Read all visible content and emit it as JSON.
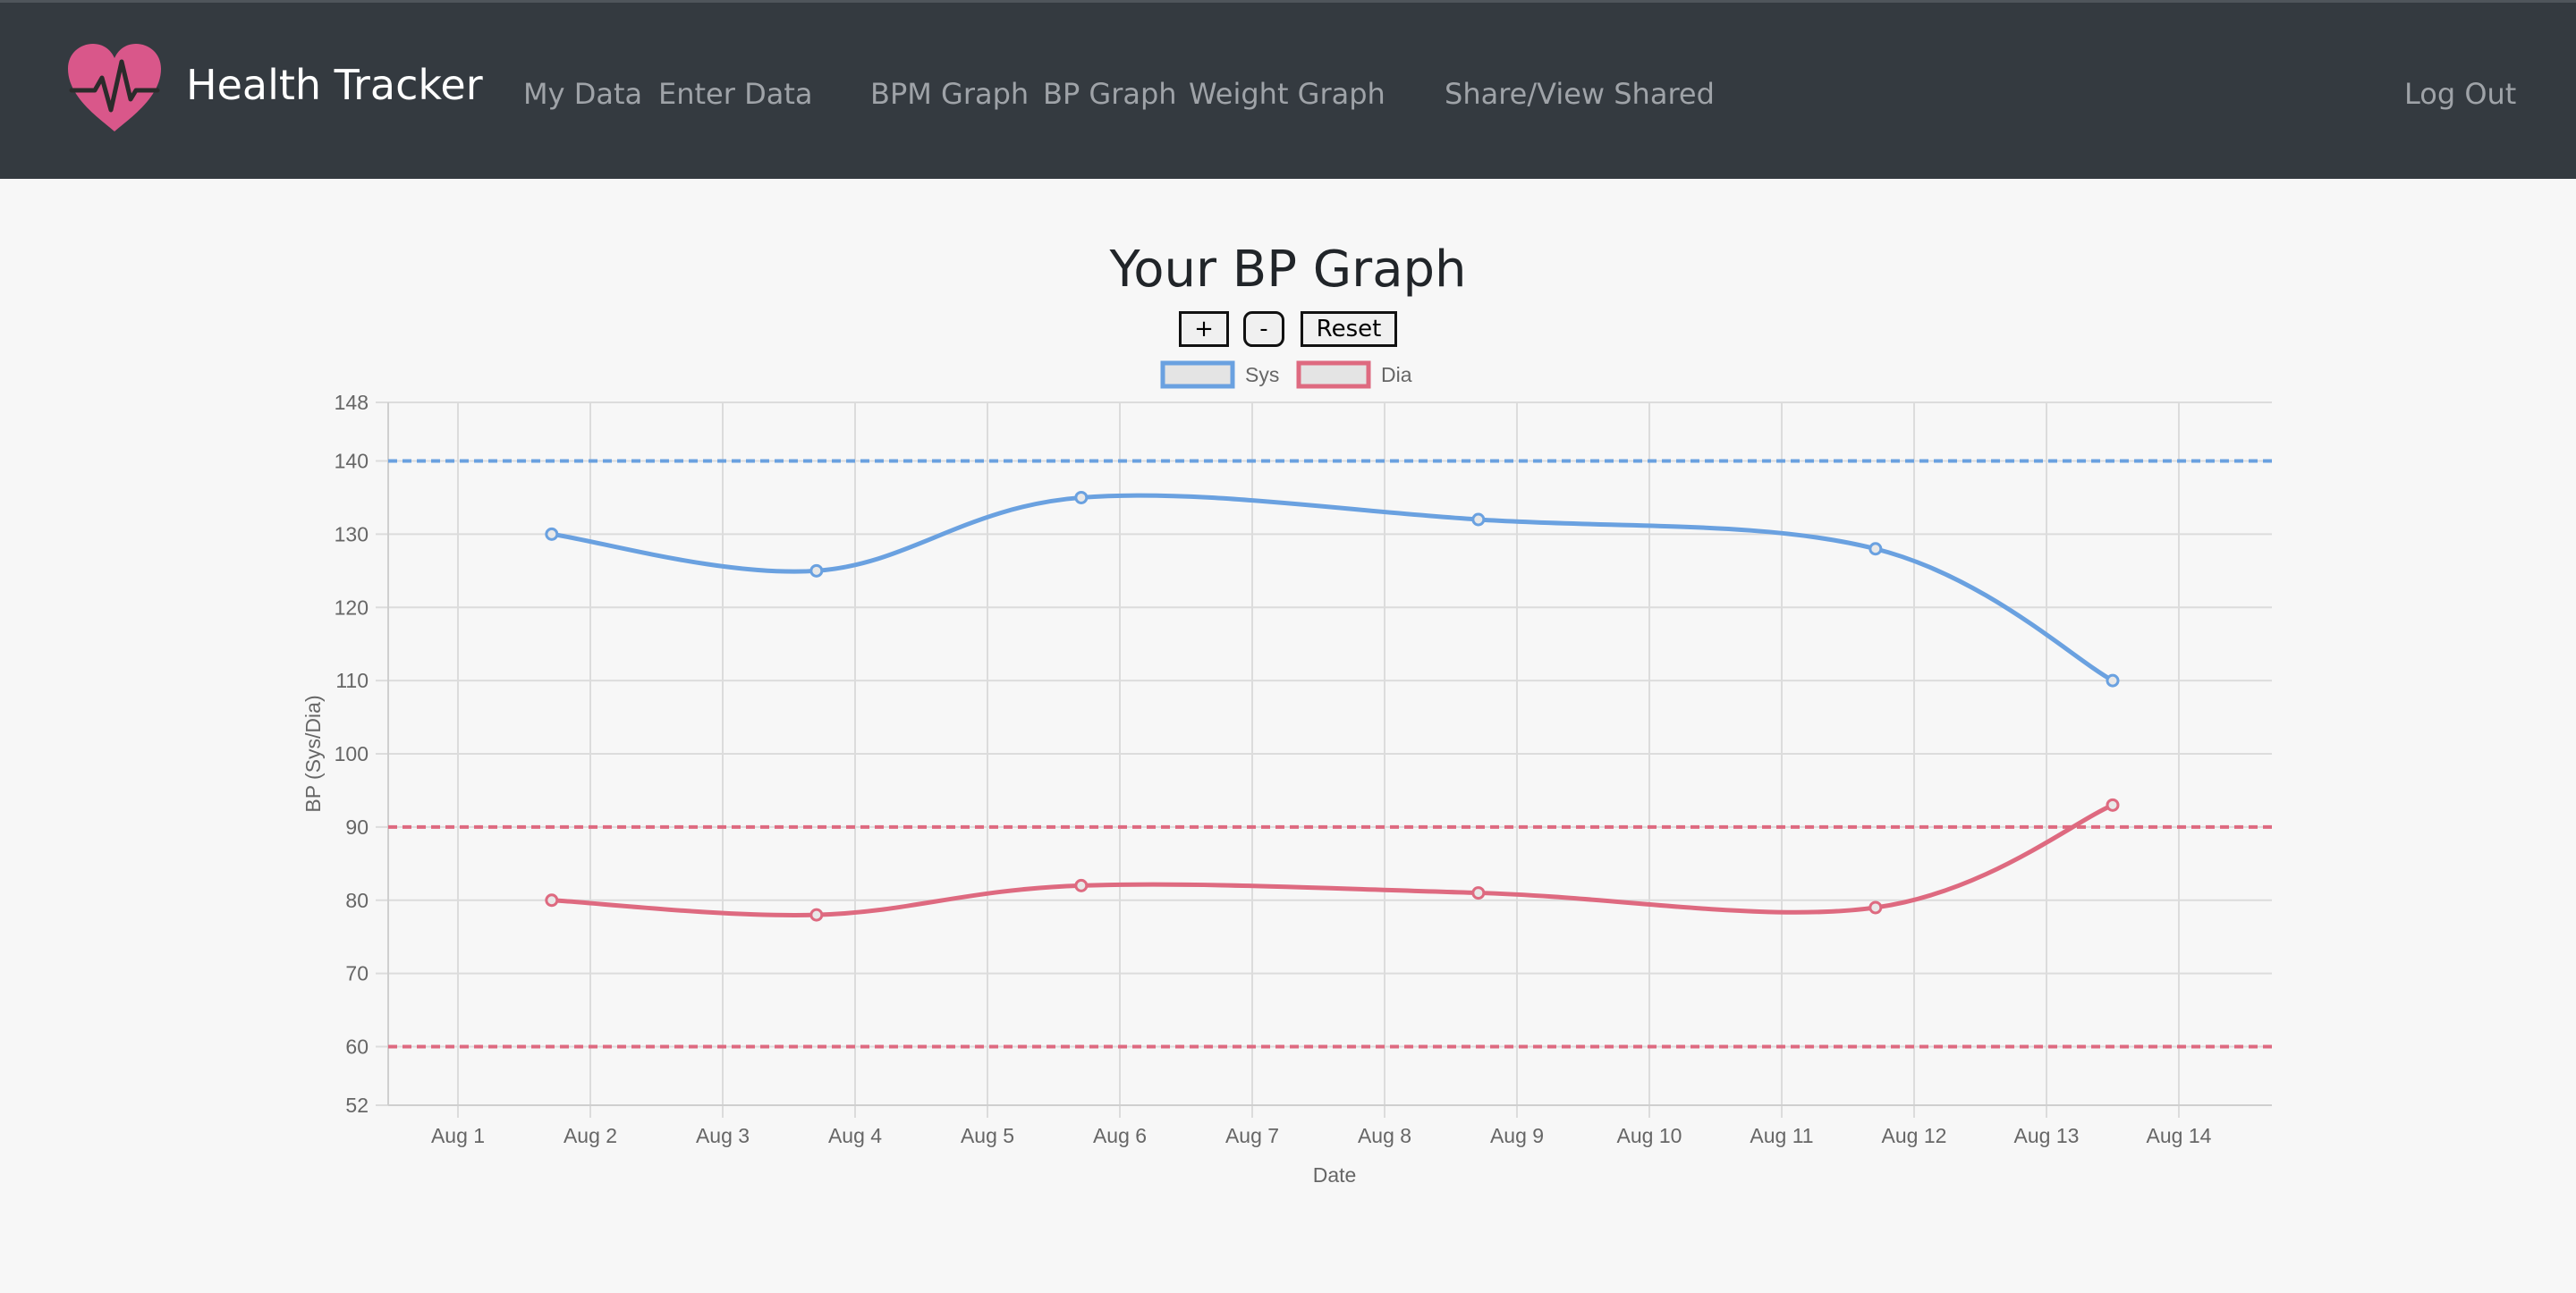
{
  "app": {
    "name": "Health Tracker"
  },
  "nav": {
    "items": [
      {
        "label": "My Data"
      },
      {
        "label": "Enter Data"
      },
      {
        "label": "BPM Graph"
      },
      {
        "label": "BP Graph"
      },
      {
        "label": "Weight Graph"
      },
      {
        "label": "Share/View Shared"
      }
    ],
    "logout": "Log Out"
  },
  "page": {
    "title": "Your BP Graph"
  },
  "controls": {
    "zoom_in": "+",
    "zoom_out": "-",
    "reset": "Reset"
  },
  "colors": {
    "navbar": "#343a40",
    "logo": "#d9578a",
    "sys": "#6aa1e0",
    "dia": "#de6a80"
  },
  "chart_data": {
    "type": "line",
    "xlabel": "Date",
    "ylabel": "BP (Sys/Dia)",
    "x_ticks": [
      "Aug 1",
      "Aug 2",
      "Aug 3",
      "Aug 4",
      "Aug 5",
      "Aug 6",
      "Aug 7",
      "Aug 8",
      "Aug 9",
      "Aug 10",
      "Aug 11",
      "Aug 12",
      "Aug 13",
      "Aug 14"
    ],
    "ylim": [
      52,
      148
    ],
    "y_ticks": [
      148,
      140,
      130,
      120,
      110,
      100,
      90,
      80,
      70,
      60,
      52
    ],
    "grid": true,
    "legend_position": "top",
    "series": [
      {
        "name": "Sys",
        "color": "#6aa1e0",
        "points": [
          {
            "x": "Aug 1 17:00",
            "y": 130
          },
          {
            "x": "Aug 3 17:00",
            "y": 125
          },
          {
            "x": "Aug 5 17:00",
            "y": 135
          },
          {
            "x": "Aug 8 17:00",
            "y": 132
          },
          {
            "x": "Aug 11 17:00",
            "y": 128
          },
          {
            "x": "Aug 13 12:00",
            "y": 110
          }
        ]
      },
      {
        "name": "Dia",
        "color": "#de6a80",
        "points": [
          {
            "x": "Aug 1 17:00",
            "y": 80
          },
          {
            "x": "Aug 3 17:00",
            "y": 78
          },
          {
            "x": "Aug 5 17:00",
            "y": 82
          },
          {
            "x": "Aug 8 17:00",
            "y": 81
          },
          {
            "x": "Aug 11 17:00",
            "y": 79
          },
          {
            "x": "Aug 13 12:00",
            "y": 93
          }
        ]
      }
    ],
    "reference_lines": [
      {
        "y": 140,
        "color": "#6aa1e0",
        "style": "dashed"
      },
      {
        "y": 90,
        "color": "#de6a80",
        "style": "dashed"
      },
      {
        "y": 60,
        "color": "#de6a80",
        "style": "dashed"
      }
    ]
  }
}
